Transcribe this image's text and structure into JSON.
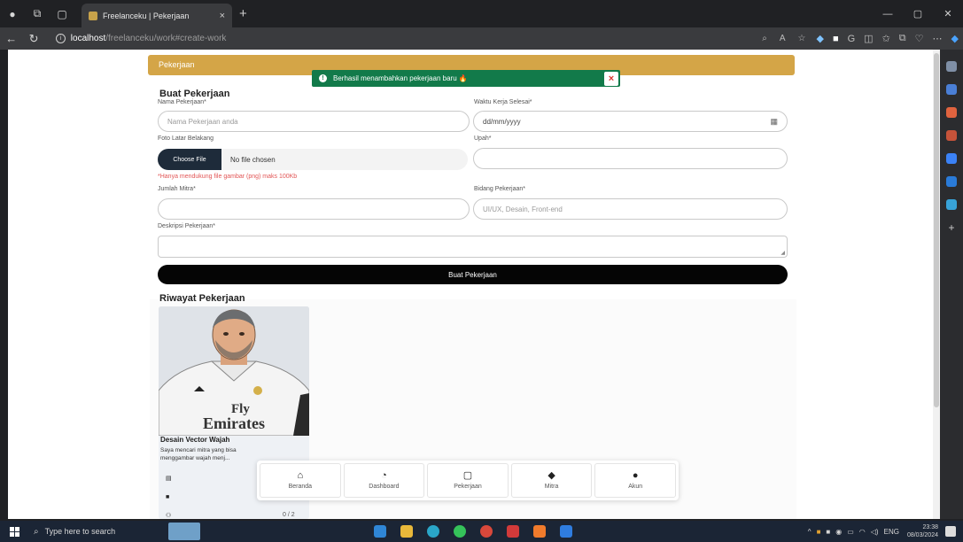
{
  "browser": {
    "tab_title": "Freelanceku | Pekerjaan",
    "tab_close": "×",
    "new_tab": "+",
    "url_host": "localhost",
    "url_path": "/freelanceku/work#create-work"
  },
  "page": {
    "header": "Pekerjaan",
    "toast_message": "Berhasil menambahkan pekerjaan baru 🔥",
    "toast_close": "×",
    "form_title": "Buat Pekerjaan",
    "fields": {
      "nama_label": "Nama Pekerjaan*",
      "nama_placeholder": "Nama Pekerjaan anda",
      "waktu_label": "Waktu Kerja Selesai*",
      "waktu_value": "dd/mm/yyyy",
      "foto_label": "Foto Latar Belakang",
      "file_button": "Choose File",
      "file_status": "No file chosen",
      "file_hint": "*Hanya mendukung file gambar (png) maks 100Kb",
      "upah_label": "Upah*",
      "jumlah_label": "Jumlah Mitra*",
      "bidang_label": "Bidang Pekerjaan*",
      "bidang_placeholder": "UI/UX, Desain, Front-end",
      "deskripsi_label": "Deskripsi Pekerjaan*"
    },
    "submit_label": "Buat Pekerjaan",
    "history_title": "Riwayat Pekerjaan",
    "job_card": {
      "title": "Desain Vector Wajah",
      "description": "Saya mencari mitra yang bisa menggambar wajah menj...",
      "jersey_line1": "Fly",
      "jersey_line2": "Emirates",
      "count": "0 / 2"
    }
  },
  "bottom_nav": [
    {
      "label": "Beranda",
      "icon": "home-icon"
    },
    {
      "label": "Dashboard",
      "icon": "dashboard-icon"
    },
    {
      "label": "Pekerjaan",
      "icon": "briefcase-icon"
    },
    {
      "label": "Mitra",
      "icon": "handshake-icon"
    },
    {
      "label": "Akun",
      "icon": "user-icon"
    }
  ],
  "taskbar": {
    "search_placeholder": "Type here to search",
    "language": "ENG",
    "time": "23:38",
    "date": "08/03/2024"
  },
  "colors": {
    "header": "#d4a547",
    "toast": "#127a4a",
    "submit": "#050505",
    "file_button": "#1e2b3a"
  }
}
